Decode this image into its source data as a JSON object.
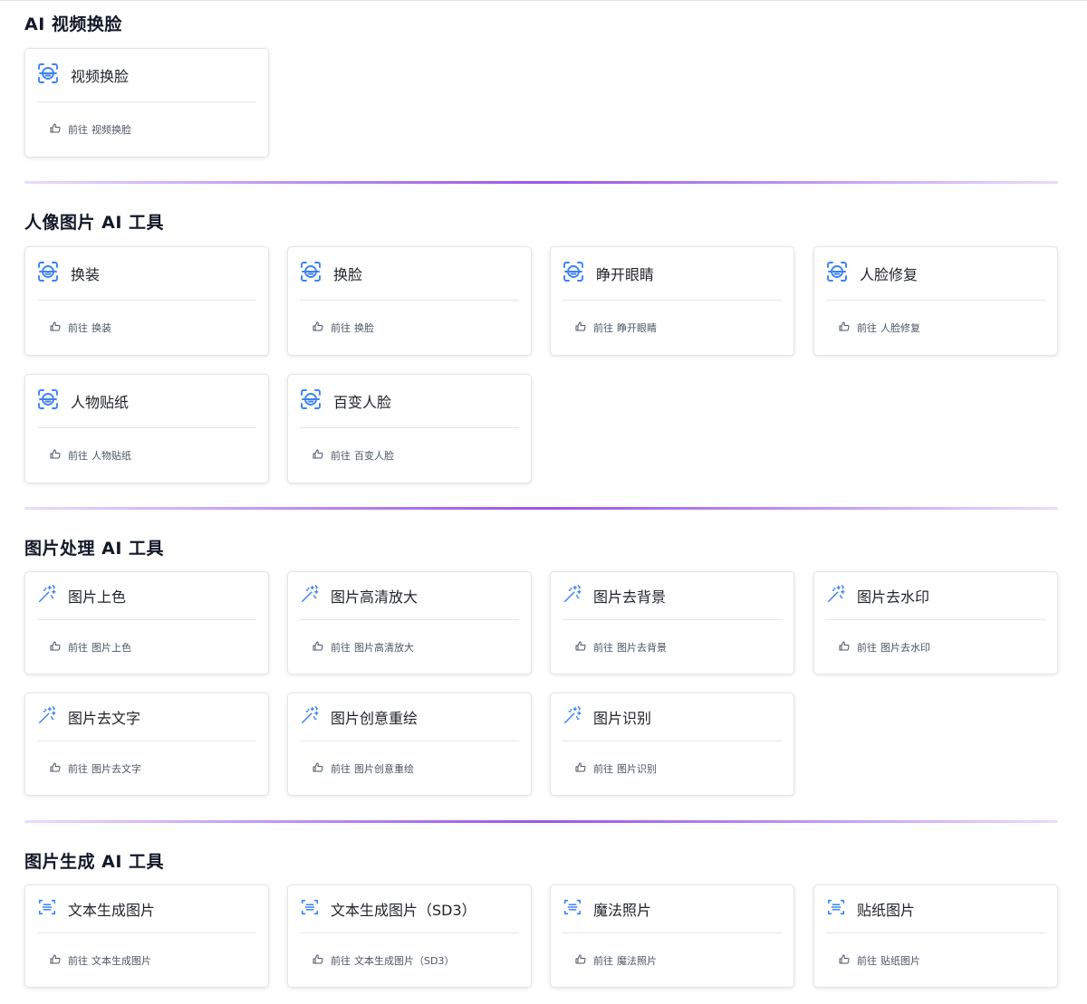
{
  "sections": [
    {
      "title": "AI 视频换脸",
      "icon": "face-scan-icon",
      "cards": [
        {
          "title": "视频换脸",
          "go": "前往",
          "target": "视频换脸"
        }
      ]
    },
    {
      "title": "人像图片 AI 工具",
      "icon": "face-scan-icon",
      "cards": [
        {
          "title": "换装",
          "go": "前往",
          "target": "换装"
        },
        {
          "title": "换脸",
          "go": "前往",
          "target": "换脸"
        },
        {
          "title": "睁开眼睛",
          "go": "前往",
          "target": "睁开眼睛"
        },
        {
          "title": "人脸修复",
          "go": "前往",
          "target": "人脸修复"
        },
        {
          "title": "人物贴纸",
          "go": "前往",
          "target": "人物贴纸"
        },
        {
          "title": "百变人脸",
          "go": "前往",
          "target": "百变人脸"
        }
      ]
    },
    {
      "title": "图片处理 AI 工具",
      "icon": "magic-wand-icon",
      "cards": [
        {
          "title": "图片上色",
          "go": "前往",
          "target": "图片上色"
        },
        {
          "title": "图片高清放大",
          "go": "前往",
          "target": "图片高清放大"
        },
        {
          "title": "图片去背景",
          "go": "前往",
          "target": "图片去背景"
        },
        {
          "title": "图片去水印",
          "go": "前往",
          "target": "图片去水印"
        },
        {
          "title": "图片去文字",
          "go": "前往",
          "target": "图片去文字"
        },
        {
          "title": "图片创意重绘",
          "go": "前往",
          "target": "图片创意重绘"
        },
        {
          "title": "图片识别",
          "go": "前往",
          "target": "图片识别"
        }
      ]
    },
    {
      "title": "图片生成 AI 工具",
      "icon": "text-scan-icon",
      "cards": [
        {
          "title": "文本生成图片",
          "go": "前往",
          "target": "文本生成图片"
        },
        {
          "title": "文本生成图片（SD3）",
          "go": "前往",
          "target": "文本生成图片（SD3）"
        },
        {
          "title": "魔法照片",
          "go": "前往",
          "target": "魔法照片"
        },
        {
          "title": "贴纸图片",
          "go": "前往",
          "target": "贴纸图片"
        }
      ]
    }
  ],
  "colors": {
    "icon_blue": "#3b82f6",
    "divider_purple": "#9b57e6"
  }
}
